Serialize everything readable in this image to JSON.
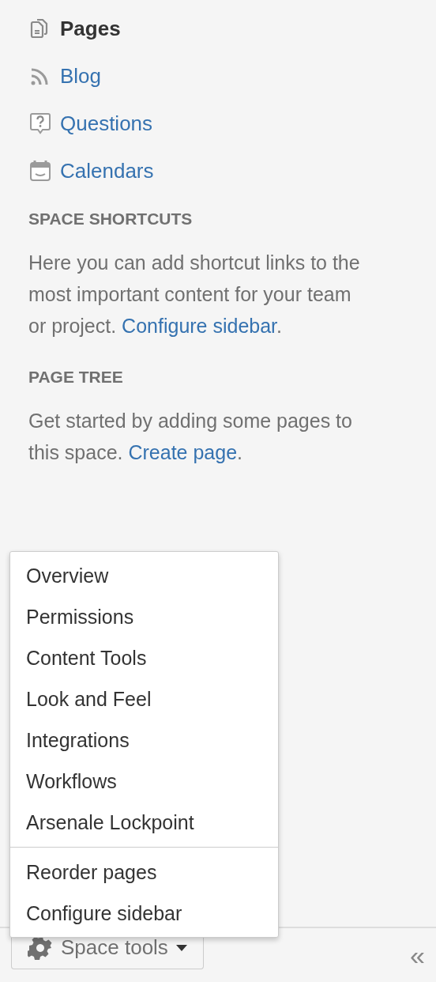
{
  "nav": [
    {
      "label": "Pages",
      "kind": "pages",
      "selected": true
    },
    {
      "label": "Blog",
      "kind": "blog",
      "selected": false
    },
    {
      "label": "Questions",
      "kind": "questions",
      "selected": false
    },
    {
      "label": "Calendars",
      "kind": "calendars",
      "selected": false
    }
  ],
  "sections": [
    {
      "heading": "SPACE SHORTCUTS",
      "text": "Here you can add shortcut links to the most important content for your team or project. ",
      "link": "Configure sidebar",
      "after": "."
    },
    {
      "heading": "PAGE TREE",
      "text": "Get started by adding some pages to this space. ",
      "link": "Create page",
      "after": "."
    }
  ],
  "menu": {
    "groups": [
      [
        "Overview",
        "Permissions",
        "Content Tools",
        "Look and Feel",
        "Integrations",
        "Workflows",
        "Arsenale Lockpoint"
      ],
      [
        "Reorder pages",
        "Configure sidebar"
      ]
    ]
  },
  "footer": {
    "button": "Space tools",
    "collapse": "«"
  }
}
